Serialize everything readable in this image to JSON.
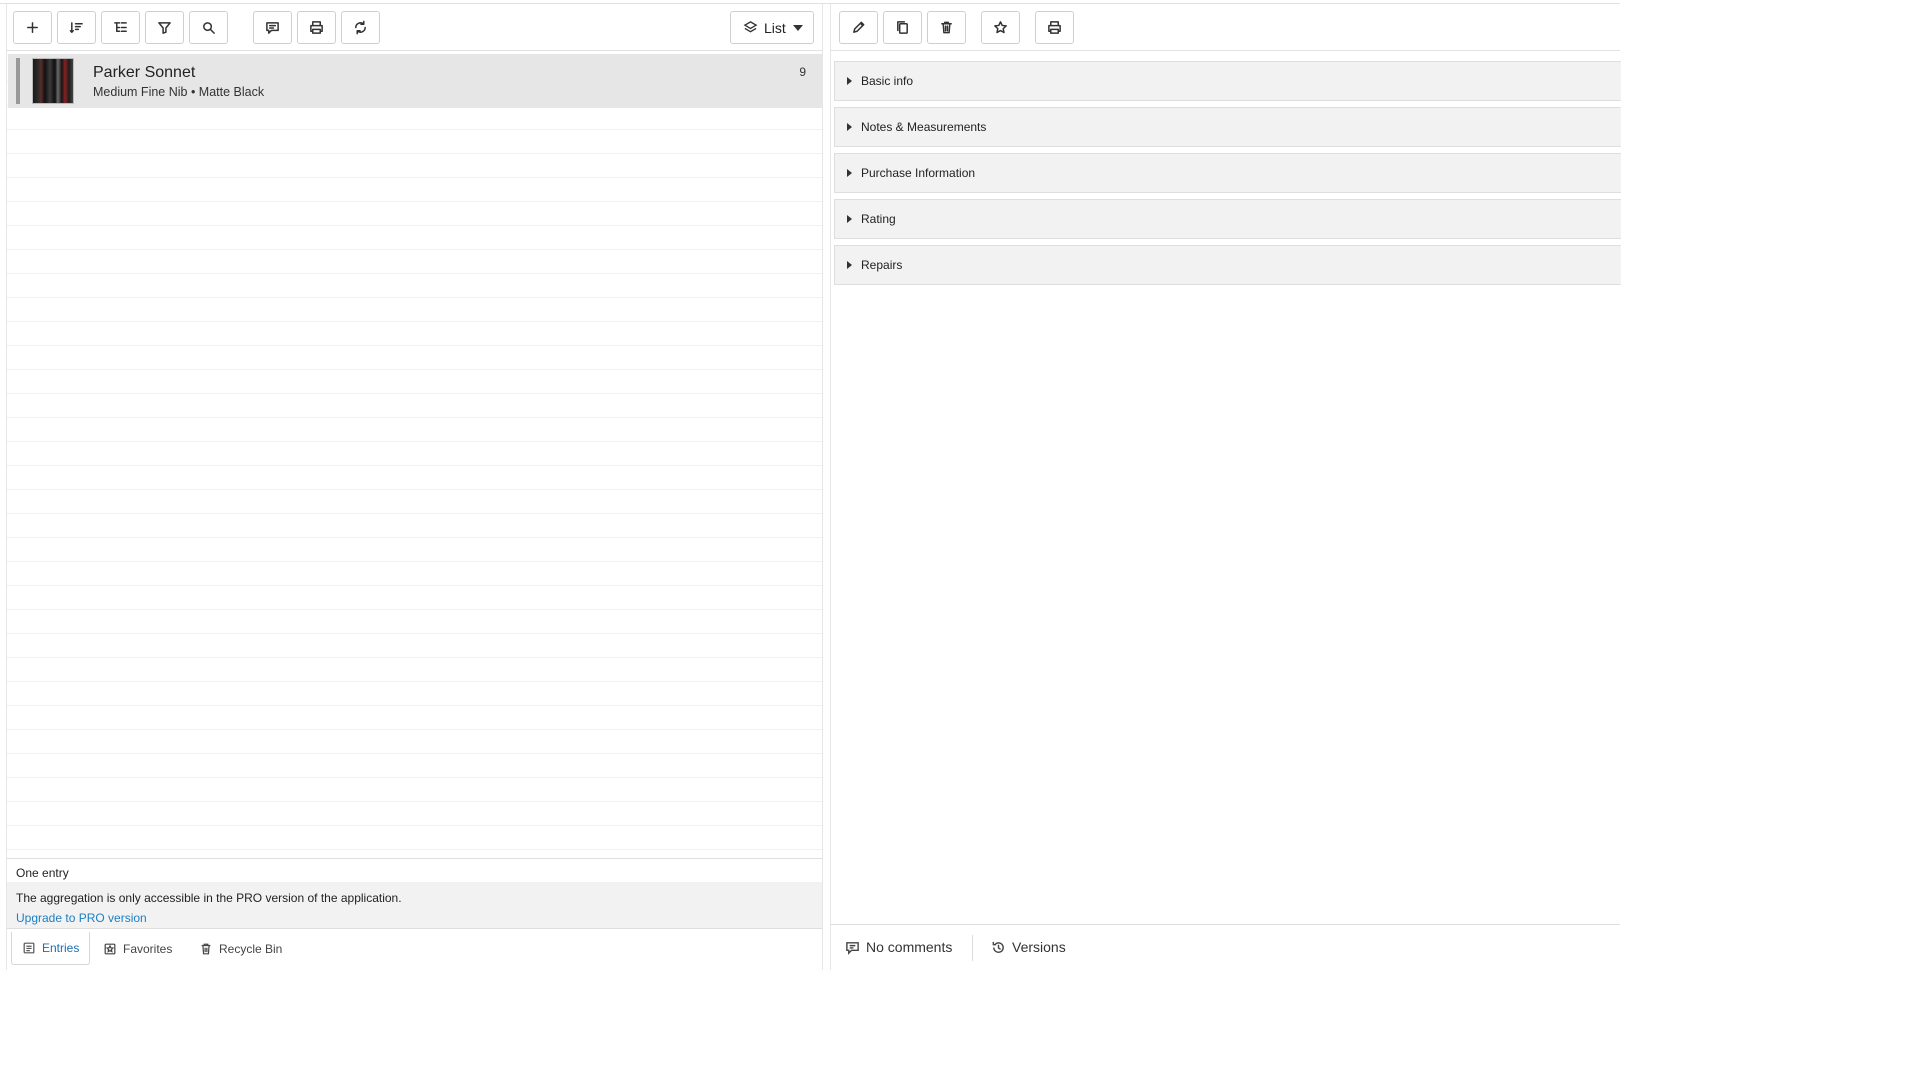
{
  "left_toolbar": {
    "buttons": [
      {
        "name": "add-entry-button",
        "icon": "plus-icon"
      },
      {
        "name": "sort-button",
        "icon": "sort-icon"
      },
      {
        "name": "group-button",
        "icon": "tree-icon"
      },
      {
        "name": "filter-button",
        "icon": "filter-icon"
      },
      {
        "name": "search-button",
        "icon": "search-icon"
      },
      {
        "name": "comment-button",
        "icon": "comment-icon"
      },
      {
        "name": "print-button",
        "icon": "printer-icon"
      },
      {
        "name": "refresh-button",
        "icon": "refresh-icon"
      }
    ],
    "view_select": {
      "label": "List",
      "icon": "layers-icon"
    }
  },
  "entries": [
    {
      "title": "Parker  Sonnet",
      "subtitle": "Medium Fine Nib • Matte Black",
      "count": "9"
    }
  ],
  "status": {
    "count_text": "One entry",
    "notice": "The aggregation is only accessible in the PRO version of the application.",
    "upgrade_link": "Upgrade to PRO version"
  },
  "bottom_tabs": [
    {
      "label": "Entries",
      "icon": "list-icon",
      "active": true
    },
    {
      "label": "Favorites",
      "icon": "star-box-icon",
      "active": false
    },
    {
      "label": "Recycle Bin",
      "icon": "trash-icon",
      "active": false
    }
  ],
  "right_toolbar": {
    "buttons": [
      {
        "name": "edit-button",
        "icon": "pencil-icon"
      },
      {
        "name": "duplicate-button",
        "icon": "copy-icon"
      },
      {
        "name": "delete-button",
        "icon": "trash-icon"
      },
      {
        "name": "favorite-button",
        "icon": "star-icon"
      },
      {
        "name": "print-entry-button",
        "icon": "printer-icon"
      }
    ]
  },
  "sections": [
    {
      "label": "Basic info"
    },
    {
      "label": "Notes & Measurements"
    },
    {
      "label": "Purchase Information"
    },
    {
      "label": "Rating"
    },
    {
      "label": "Repairs"
    }
  ],
  "footer": {
    "comments_label": "No comments",
    "versions_label": "Versions"
  },
  "colors": {
    "link": "#1a7fc4",
    "active_tab_text": "#1a6fb0",
    "selected_row": "#e6e6e6",
    "section_bg": "#f2f2f2"
  }
}
